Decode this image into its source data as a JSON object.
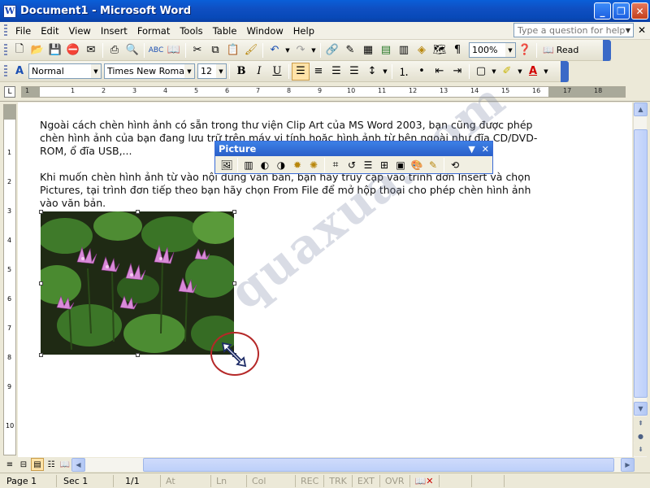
{
  "window": {
    "title": "Document1 - Microsoft Word",
    "app_icon_letter": "W"
  },
  "menu": {
    "items": [
      "File",
      "Edit",
      "View",
      "Insert",
      "Format",
      "Tools",
      "Table",
      "Window",
      "Help"
    ],
    "help_placeholder": "Type a question for help"
  },
  "standard_toolbar": {
    "zoom": "100%",
    "read_label": "Read"
  },
  "formatting_toolbar": {
    "style": "Normal",
    "font": "Times New Roman",
    "size": "12",
    "bold": "B",
    "italic": "I",
    "underline": "U"
  },
  "ruler": {
    "numbers": [
      "1",
      "1",
      "2",
      "3",
      "4",
      "5",
      "6",
      "7",
      "8",
      "9",
      "10",
      "11",
      "12",
      "13",
      "14",
      "15",
      "16",
      "17",
      "18"
    ]
  },
  "vruler": {
    "numbers": [
      "1",
      "2",
      "3",
      "4",
      "5",
      "6",
      "7",
      "8",
      "9",
      "10"
    ]
  },
  "document": {
    "paragraph1": "Ngoài cách chèn hình ảnh có sẵn trong thư viện Clip Art của MS Word 2003, bạn cũng được phép chèn hình ảnh của bạn đang lưu trữ trên máy vi tính hoặc hình ảnh từ bên ngoài như đĩa CD/DVD-ROM, ổ đĩa USB,...",
    "paragraph2": "Khi muốn chèn hình ảnh từ vào nội dung văn bản, bạn hãy truy cập vào trình đơn Insert và chọn Pictures, tại trình đơn tiếp theo bạn hãy chọn From File để mở hộp thoại cho phép chèn hình ảnh vào văn bản."
  },
  "picture_toolbar": {
    "title": "Picture"
  },
  "watermark": "quaxua.com",
  "status": {
    "page": "Page 1",
    "sec": "Sec 1",
    "pages": "1/1",
    "at": "At",
    "ln": "Ln",
    "col": "Col",
    "rec": "REC",
    "trk": "TRK",
    "ext": "EXT",
    "ovr": "OVR"
  }
}
